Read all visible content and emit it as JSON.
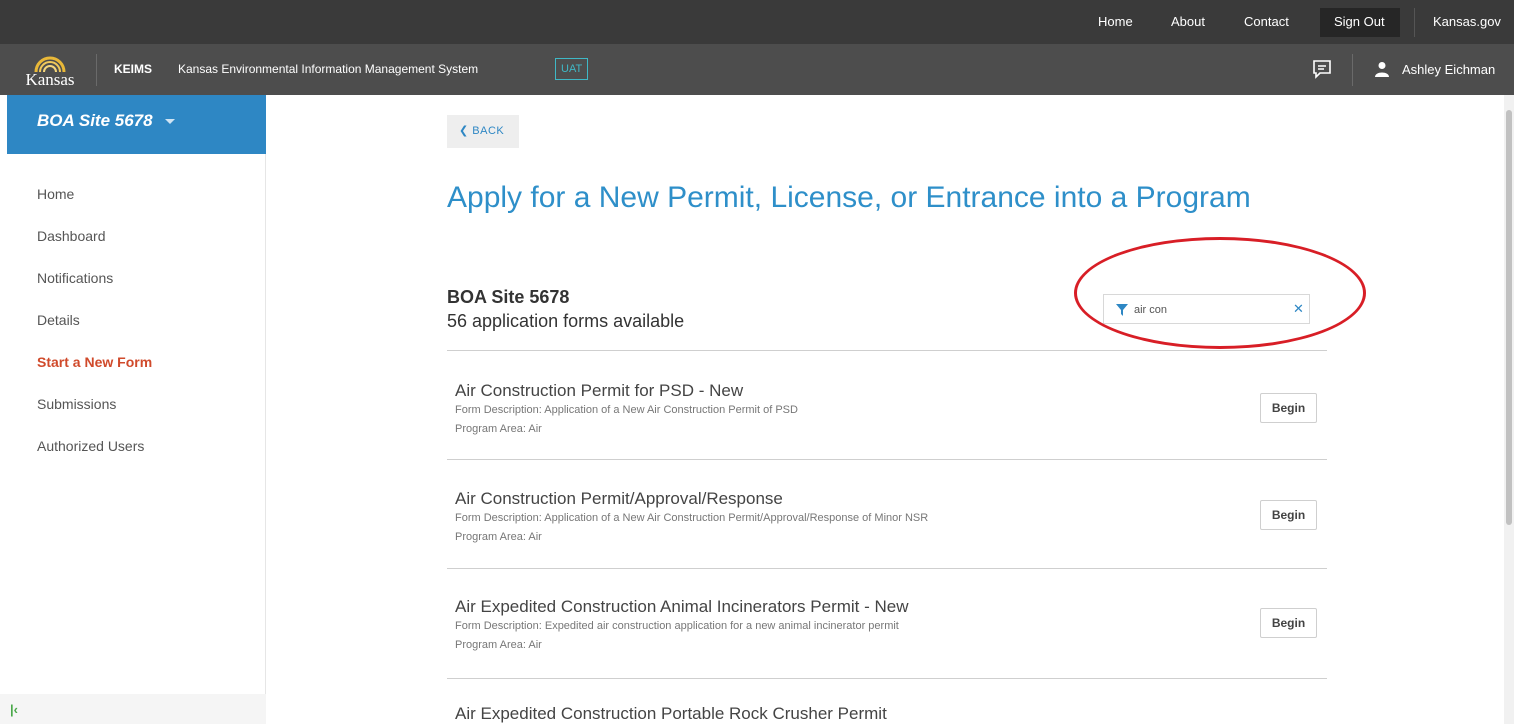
{
  "topnav": {
    "home": "Home",
    "about": "About",
    "contact": "Contact",
    "sign_out": "Sign Out",
    "kansas_gov": "Kansas.gov"
  },
  "appbar": {
    "logo_text": "Kansas",
    "app_short": "KEIMS",
    "app_full": "Kansas Environmental Information Management System",
    "env_badge": "UAT",
    "user_name": "Ashley Eichman"
  },
  "sidebar": {
    "site_name": "BOA Site 5678",
    "items": [
      {
        "label": "Home"
      },
      {
        "label": "Dashboard"
      },
      {
        "label": "Notifications"
      },
      {
        "label": "Details"
      },
      {
        "label": "Start a New Form"
      },
      {
        "label": "Submissions"
      },
      {
        "label": "Authorized Users"
      }
    ],
    "active_item": "Start a New Form"
  },
  "main": {
    "back_label": "BACK",
    "title": "Apply for a New Permit, License, or Entrance into a Program",
    "site_name": "BOA Site 5678",
    "forms_available": "56 application forms available",
    "filter_value": "air con",
    "forms": [
      {
        "title": "Air Construction Permit for PSD - New",
        "description": "Form Description: Application of a New Air Construction Permit of PSD",
        "program_area": "Program Area: Air",
        "button": "Begin"
      },
      {
        "title": "Air Construction Permit/Approval/Response",
        "description": "Form Description: Application of a New Air Construction Permit/Approval/Response of Minor NSR",
        "program_area": "Program Area: Air",
        "button": "Begin"
      },
      {
        "title": "Air Expedited Construction Animal Incinerators Permit - New",
        "description": "Form Description: Expedited air construction application for a new animal incinerator permit",
        "program_area": "Program Area: Air",
        "button": "Begin"
      },
      {
        "title": "Air Expedited Construction Portable Rock Crusher Permit"
      }
    ]
  },
  "colors": {
    "brand_blue": "#2e87c4",
    "active_nav": "#d04a2b",
    "badge_teal": "#3fb8c6",
    "annotation_red": "#d81e26"
  }
}
